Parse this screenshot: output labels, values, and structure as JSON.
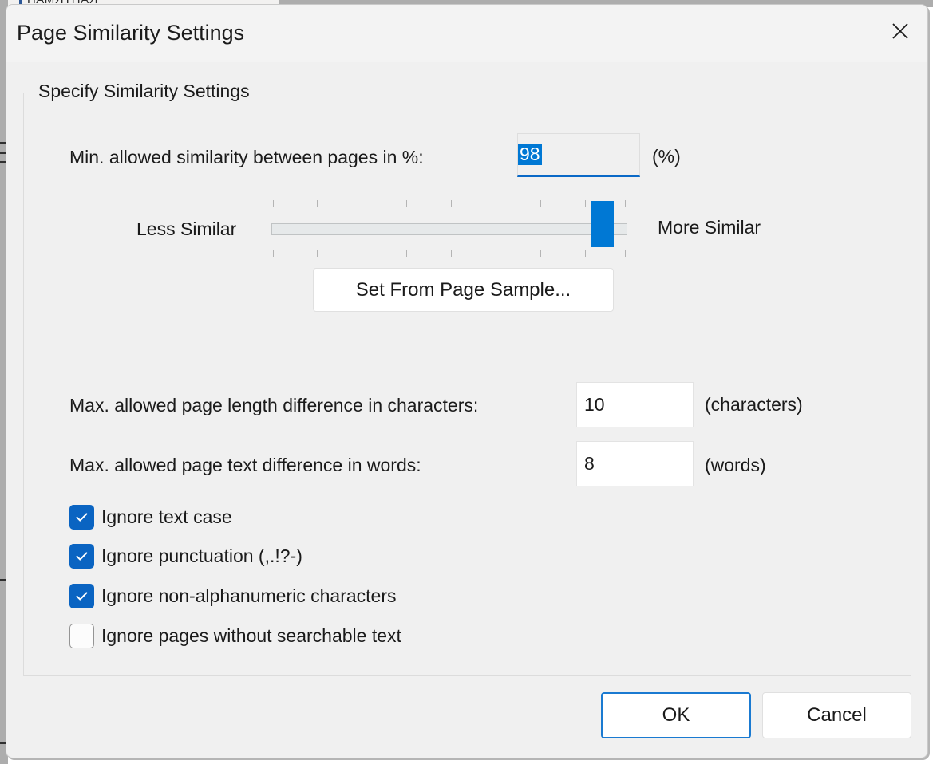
{
  "background": {
    "underlying_window_title": "ПАМЯТНАЯ"
  },
  "dialog": {
    "title": "Page Similarity Settings",
    "close_icon": "close-icon"
  },
  "group": {
    "title": "Specify Similarity Settings"
  },
  "similarity": {
    "label": "Min. allowed similarity between pages in %:",
    "value": "98",
    "unit": "(%)",
    "slider": {
      "less_label": "Less Similar",
      "more_label": "More Similar",
      "value": 98,
      "min": 0,
      "max": 100,
      "tick_count": 9
    },
    "sample_button": "Set From Page Sample..."
  },
  "length_diff": {
    "label": "Max. allowed page length difference in characters:",
    "value": "10",
    "unit": "(characters)"
  },
  "text_diff": {
    "label": "Max. allowed page text difference in words:",
    "value": "8",
    "unit": "(words)"
  },
  "checkboxes": [
    {
      "label": "Ignore text case",
      "checked": true
    },
    {
      "label": "Ignore punctuation (,.!?-)",
      "checked": true
    },
    {
      "label": "Ignore non-alphanumeric characters",
      "checked": true
    },
    {
      "label": "Ignore pages without searchable text",
      "checked": false
    }
  ],
  "footer": {
    "ok": "OK",
    "cancel": "Cancel"
  },
  "colors": {
    "accent": "#0078d4",
    "accent_dark": "#0a64c2",
    "focus_border": "#0a69c7",
    "dialog_bg": "#f0f0f0",
    "titlebar_bg": "#f3f3f3"
  }
}
